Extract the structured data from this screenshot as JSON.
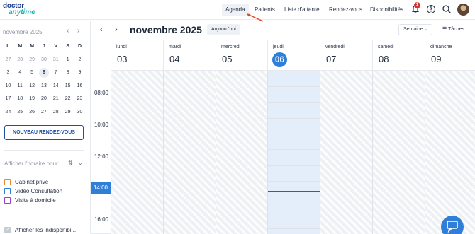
{
  "brand": {
    "line1": "doctor",
    "line2": "anytime"
  },
  "nav": {
    "items": [
      {
        "label": "Agenda",
        "active": true
      },
      {
        "label": "Patients"
      },
      {
        "label": "Liste d'attente"
      },
      {
        "label": "Rendez-vous"
      },
      {
        "label": "Disponibilités"
      }
    ],
    "notification_count": "1"
  },
  "mini_calendar": {
    "title": "novembre 2025",
    "weekdays": [
      "L",
      "M",
      "M",
      "J",
      "V",
      "S",
      "D"
    ],
    "weeks": [
      [
        "27",
        "28",
        "29",
        "30",
        "31",
        "1",
        "2"
      ],
      [
        "3",
        "4",
        "5",
        "6",
        "7",
        "8",
        "9"
      ],
      [
        "10",
        "11",
        "12",
        "13",
        "14",
        "15",
        "16"
      ],
      [
        "17",
        "18",
        "19",
        "20",
        "21",
        "22",
        "23"
      ],
      [
        "24",
        "25",
        "26",
        "27",
        "28",
        "29",
        "30"
      ]
    ]
  },
  "sidebar": {
    "new_button": "NOUVEAU RENDEZ-VOUS",
    "schedule_label": "Afficher l'horaire pour",
    "legend": [
      {
        "label": "Cabinet privé",
        "color": "#e8892b"
      },
      {
        "label": "Vidéo Consultation",
        "color": "#2f7fd9"
      },
      {
        "label": "Visite à domicile",
        "color": "#9b3fcf"
      }
    ],
    "show_unavailable": "Afficher les indisponibi..."
  },
  "calendar": {
    "title": "novembre 2025",
    "today_button": "Aujourd'hui",
    "view": "Semaine",
    "tasks": "Tâches",
    "days": [
      {
        "name": "lundi",
        "date": "03"
      },
      {
        "name": "mardi",
        "date": "04"
      },
      {
        "name": "mercredi",
        "date": "05"
      },
      {
        "name": "jeudi",
        "date": "06",
        "today": true
      },
      {
        "name": "vendredi",
        "date": "07"
      },
      {
        "name": "samedi",
        "date": "08"
      },
      {
        "name": "dimanche",
        "date": "09"
      }
    ],
    "hours": [
      "08:00",
      "10:00",
      "12:00",
      "14:00",
      "16:00"
    ],
    "current_hour": "14:00"
  },
  "colors": {
    "accent": "#2f7fd9",
    "primary_dark": "#1f4fa3",
    "brand_teal": "#17b3b5"
  }
}
